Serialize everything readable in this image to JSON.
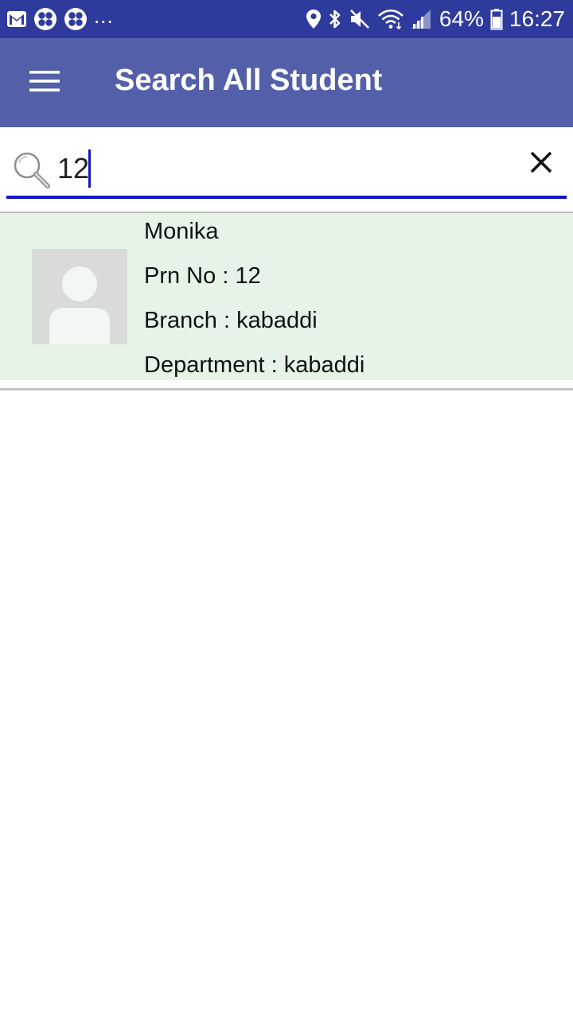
{
  "status_bar": {
    "notification_icons": [
      "gmail-icon",
      "clover-app-icon",
      "clover-app-icon"
    ],
    "overflow": "...",
    "system_icons": [
      "location-icon",
      "bluetooth-icon",
      "mute-icon",
      "wifi-icon",
      "signal-icon"
    ],
    "battery_percent": "64%",
    "time": "16:27"
  },
  "toolbar": {
    "menu_icon": "hamburger-menu-icon",
    "title": "Search All Student"
  },
  "search": {
    "icon": "search-icon",
    "value": "12",
    "clear_icon": "close-icon",
    "accent_color": "#1414c4"
  },
  "results": [
    {
      "name": "Monika",
      "prn_label": "Prn No :",
      "prn_value": "12",
      "branch_label": "Branch :",
      "branch_value": "kabaddi",
      "department_label": "Department :",
      "department_value": "kabaddi",
      "avatar": "avatar-placeholder-icon"
    }
  ],
  "colors": {
    "status_bar": "#2f3b9c",
    "toolbar": "#5360a9",
    "row_background": "#e6f4e8"
  }
}
